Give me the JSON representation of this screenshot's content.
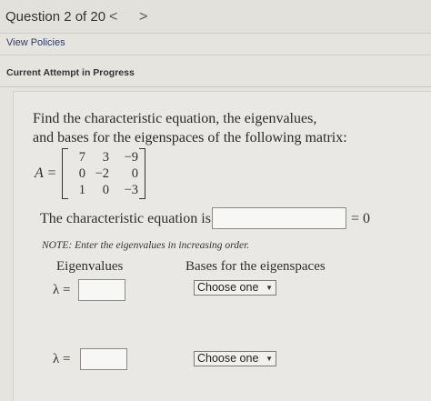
{
  "header": {
    "question_label": "Question 2 of 20",
    "prev_glyph": "<",
    "next_glyph": ">"
  },
  "links": {
    "view_policies": "View Policies"
  },
  "status": {
    "attempt": "Current Attempt in Progress"
  },
  "problem": {
    "prompt_line1": "Find the characteristic equation, the eigenvalues,",
    "prompt_line2": "and bases for the eigenspaces of the following matrix:",
    "matrix_lhs": "A =",
    "matrix": [
      [
        "7",
        "3",
        "−9"
      ],
      [
        "0",
        "−2",
        "0"
      ],
      [
        "1",
        "0",
        "−3"
      ]
    ],
    "char_eq_label": "The characteristic equation is",
    "char_eq_value": "",
    "char_eq_rhs": "= 0",
    "note": "NOTE: Enter the eigenvalues in increasing order.",
    "col_eigenvalues": "Eigenvalues",
    "col_bases": "Bases for the eigenspaces",
    "lambda_label": "λ =",
    "eigen_rows": [
      {
        "value": "",
        "basis_selected": "Choose one"
      },
      {
        "value": "",
        "basis_selected": "Choose one"
      }
    ]
  },
  "icons": {
    "prev": "chevron-left-icon",
    "next": "chevron-right-icon",
    "dropdown": "caret-down-icon"
  }
}
